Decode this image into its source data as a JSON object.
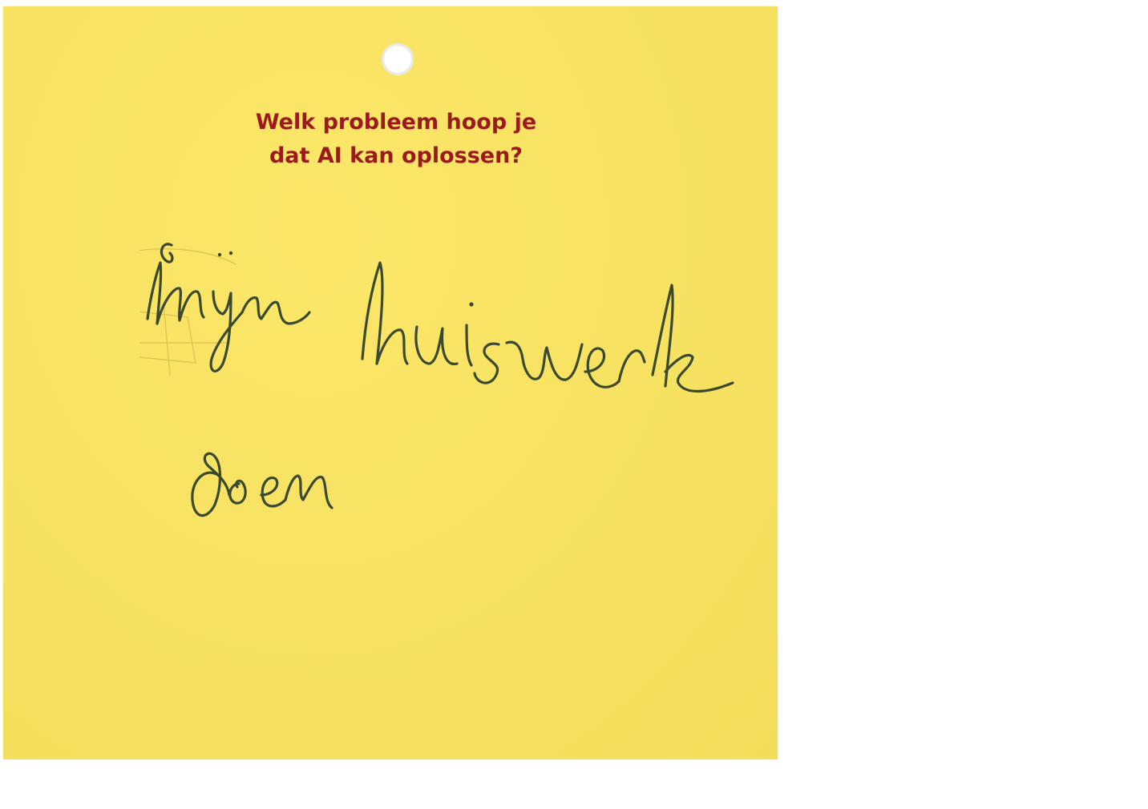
{
  "card": {
    "color": "#fbe55f",
    "question_color": "#9b1a1c",
    "question_lines": [
      "Welk probleem hoop je",
      "dat AI kan oplossen?"
    ]
  },
  "handwritten_answer": {
    "text": "mijn huiswerk doen",
    "lines": [
      "mijn huiswerk",
      "doen"
    ],
    "ink_color": "#3b4a2e"
  }
}
